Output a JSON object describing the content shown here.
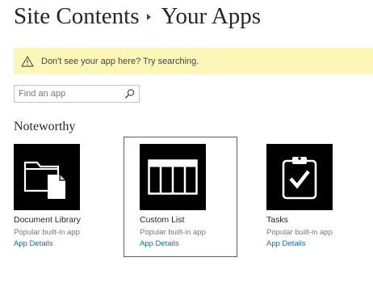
{
  "header": {
    "breadcrumb_parent": "Site Contents",
    "breadcrumb_current": "Your Apps"
  },
  "banner": {
    "message": "Don't see your app here? Try searching.",
    "icon": "warning-triangle-icon",
    "background": "#fcf7b6"
  },
  "search": {
    "placeholder": "Find an app",
    "value": "",
    "icon": "magnifier-icon"
  },
  "section": {
    "title": "Noteworthy"
  },
  "apps": [
    {
      "name": "Document Library",
      "subtitle": "Popular built-in app",
      "link": "App Details",
      "icon": "folder-document-icon"
    },
    {
      "name": "Custom List",
      "subtitle": "Popular built-in app",
      "link": "App Details",
      "icon": "table-list-icon",
      "highlighted": true
    },
    {
      "name": "Tasks",
      "subtitle": "Popular built-in app",
      "link": "App Details",
      "icon": "clipboard-check-icon"
    }
  ],
  "colors": {
    "link": "#0072c6",
    "tile_bg": "#000000",
    "highlight": "#e0262e",
    "text_dark": "#262626",
    "text_muted": "#777777"
  }
}
